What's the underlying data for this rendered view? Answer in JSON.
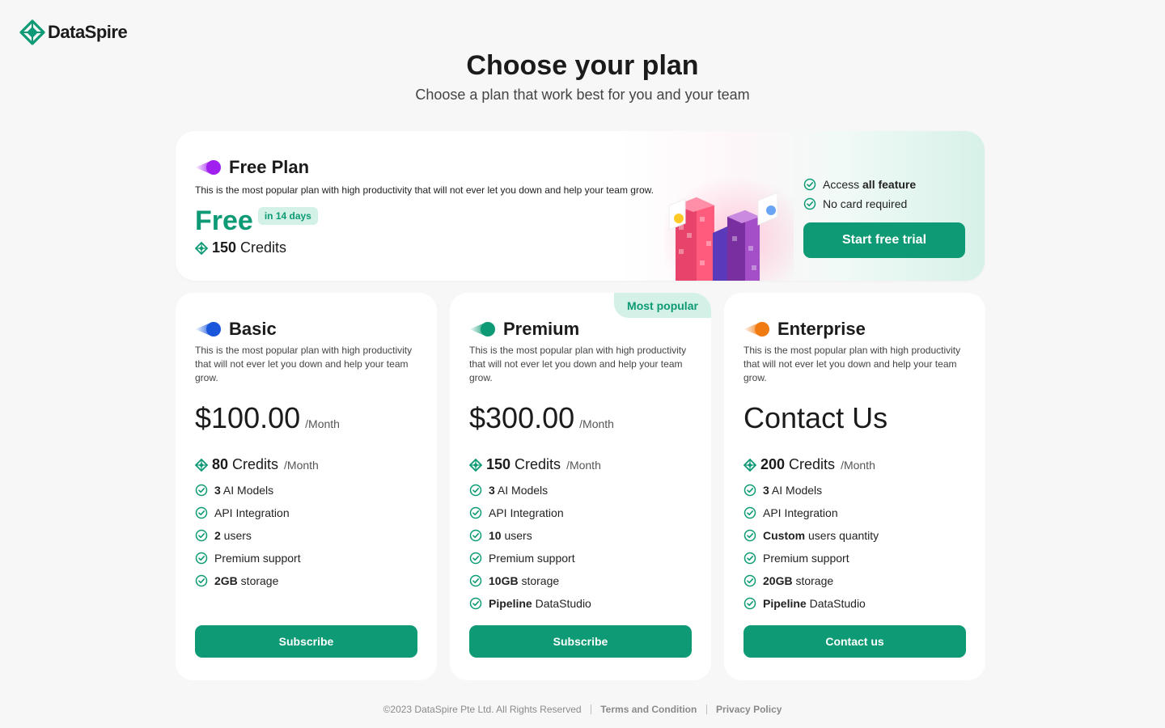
{
  "brand": {
    "name": "DataSpire",
    "accent": "#0d9a74"
  },
  "header": {
    "title": "Choose your plan",
    "subtitle": "Choose a plan that work best for you and your team"
  },
  "free_plan": {
    "name": "Free Plan",
    "description": "This is the most popular plan with high productivity that will not ever let you down and help your team grow.",
    "price": "Free",
    "badge": "in 14 days",
    "credits": "150",
    "credits_word": "Credits",
    "features": [
      {
        "pre": "Access ",
        "bold": "all feature",
        "post": ""
      },
      {
        "pre": "No card required",
        "bold": "",
        "post": ""
      }
    ],
    "button": "Start free trial"
  },
  "plans": [
    {
      "name": "Basic",
      "description": "This is the most popular plan with high productivity that will not ever let you down and help your team grow.",
      "price": "$100.00",
      "per": "/Month",
      "credits": "80",
      "credits_word": "Credits",
      "credits_per": "/Month",
      "features": [
        {
          "bold": "3",
          "text": " AI Models"
        },
        {
          "bold": "",
          "text": "API Integration"
        },
        {
          "bold": "2",
          "text": " users"
        },
        {
          "bold": "",
          "text": "Premium support"
        },
        {
          "bold": "2GB",
          "text": " storage"
        }
      ],
      "button": "Subscribe"
    },
    {
      "name": "Premium",
      "badge": "Most popular",
      "description": "This is the most popular plan with high productivity that will not ever let you down and help your team grow.",
      "price": "$300.00",
      "per": "/Month",
      "credits": "150",
      "credits_word": "Credits",
      "credits_per": "/Month",
      "features": [
        {
          "bold": "3",
          "text": " AI Models"
        },
        {
          "bold": "",
          "text": "API Integration"
        },
        {
          "bold": "10",
          "text": " users"
        },
        {
          "bold": "",
          "text": "Premium support"
        },
        {
          "bold": "10GB",
          "text": " storage"
        },
        {
          "bold": "Pipeline",
          "text": " DataStudio"
        }
      ],
      "button": "Subscribe"
    },
    {
      "name": "Enterprise",
      "description": "This is the most popular plan with high productivity that will not ever let you down and help your team grow.",
      "price": "Contact Us",
      "credits": "200",
      "credits_word": "Credits",
      "credits_per": "/Month",
      "features": [
        {
          "bold": "3",
          "text": " AI Models"
        },
        {
          "bold": "",
          "text": "API Integration"
        },
        {
          "bold": "Custom",
          "text": " users quantity"
        },
        {
          "bold": "",
          "text": "Premium support"
        },
        {
          "bold": "20GB",
          "text": " storage"
        },
        {
          "bold": "Pipeline",
          "text": " DataStudio"
        }
      ],
      "button": "Contact us"
    }
  ],
  "footer": {
    "copyright": "©2023 DataSpire Pte Ltd. All Rights Reserved",
    "terms": "Terms and Condition",
    "privacy": "Privacy Policy"
  },
  "icons": {
    "logo": "diamond-logo-icon",
    "credit": "diamond-credit-icon",
    "check": "check-circle-icon",
    "plan_marker": "comet-icon"
  },
  "colors": {
    "free_plan_icon": "#a020f0",
    "basic_icon": "#1a56db",
    "premium_icon": "#0d9a74",
    "enterprise_icon": "#f07b12"
  }
}
